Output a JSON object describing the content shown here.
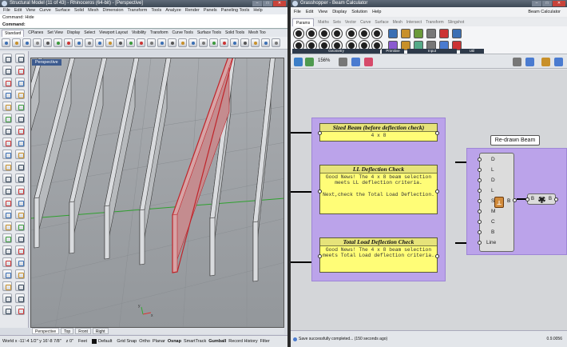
{
  "rhino": {
    "title": "Structural Model (11 of 43) - Rhinoceros (64-bit) - [Perspective]",
    "menu": [
      "File",
      "Edit",
      "View",
      "Curve",
      "Surface",
      "Solid",
      "Mesh",
      "Dimension",
      "Transform",
      "Tools",
      "Analyze",
      "Render",
      "Panels",
      "Paneling Tools",
      "Help"
    ],
    "command_history": "Command: Hide",
    "command_prompt": "Command:",
    "toolbar_tabs": [
      "Standard",
      "CPlanes",
      "Set View",
      "Display",
      "Select",
      "Viewport Layout",
      "Visibility",
      "Transform",
      "Curve Tools",
      "Surface Tools",
      "Solid Tools",
      "Mesh Too"
    ],
    "viewport_title": "Perspective",
    "viewport_tabs": [
      "Perspective",
      "Top",
      "Front",
      "Right"
    ],
    "status": {
      "coords": "World  x -11'-4 1/2\"  y 16'-8 7/8\"",
      "z": "z 0\"",
      "units": "Feet",
      "layer": "Default",
      "toggles": [
        "Grid Snap",
        "Ortho",
        "Planar",
        "Osnap",
        "SmartTrack",
        "Gumball",
        "Record History",
        "Filter"
      ]
    },
    "colors": {
      "selected_joist": "#c0242a",
      "viewport_bg": "#9ea2a6",
      "grid_x_axis": "#2fa12f"
    }
  },
  "grasshopper": {
    "title": "Grasshopper - Beam Calculator",
    "menu": [
      "File",
      "Edit",
      "View",
      "Display",
      "Solution",
      "Help"
    ],
    "file_name": "Beam Calculator",
    "tabs": [
      "Params",
      "Maths",
      "Sets",
      "Vector",
      "Curve",
      "Surface",
      "Mesh",
      "Intersect",
      "Transform",
      "Slingshot"
    ],
    "ribbon_groups": [
      "Geometry",
      "Primitive",
      "Input",
      "Util"
    ],
    "zoom": "156%",
    "panels": [
      {
        "title": "Sized Beam (before deflection check)",
        "body": "4 x 8"
      },
      {
        "title": "LL Deflection Check",
        "body": "Good News! The 4 x 8 beam selection meets LL deflection criteria.\n\nNext,check the Total Load Deflection."
      },
      {
        "title": "Total Load Deflection Check",
        "body": "Good News! The 4 x 8 beam selection meets Total Load deflection criteria."
      }
    ],
    "component": {
      "title": "Re-drawn Beam",
      "inputs": [
        "D",
        "L",
        "D",
        "L",
        "S",
        "M",
        "C",
        "B",
        "Line"
      ],
      "output": "B",
      "small_node_in": "B",
      "small_node_out": "B"
    },
    "status_text": "Save successfully completed... (150 seconds ago)",
    "version": "0.9.0056",
    "colors": {
      "group": "#bba3ea",
      "panel": "#fffd77",
      "panel_header": "#e6e37a"
    }
  }
}
